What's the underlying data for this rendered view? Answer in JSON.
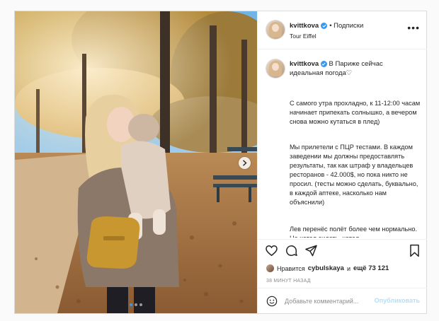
{
  "post": {
    "username": "kvittkova",
    "follow_label": "• Подписки",
    "location": "Tour Eiffel",
    "caption_first": "В Париже сейчас идеальная погода♡",
    "paragraphs": [
      "С самого утра прохладно, к 11-12:00 часам начинает припекать солнышко, а вечером снова можно кутаться в плед)",
      "Мы прилетели с ПЦР тестами. В каждом заведении мы должны предоставлять результаты, так как штраф у владельцев ресторанов - 42.000$, но пока никто не просил. (тесты можно сделать, буквально, в каждой аптеке, насколько нам объяснили)",
      "Лев перенёс полёт более чем нормально. Не хотел сидеть, хотел"
    ],
    "likes_prefix": "Нравится",
    "likes_user": "cybulskaya",
    "likes_mid": "и",
    "likes_count": "ещё 73 121",
    "time_ago": "38 МИНУТ НАЗАД",
    "comment_placeholder": "Добавьте комментарий...",
    "publish_label": "Опубликовать",
    "carousel": {
      "total": 3,
      "current": 1
    }
  },
  "icons": {
    "verified": "verified-badge-icon",
    "more": "more-options-icon",
    "like": "heart-icon",
    "comment": "comment-icon",
    "share": "share-icon",
    "save": "bookmark-icon",
    "emoji": "emoji-icon",
    "next": "chevron-right-icon"
  },
  "colors": {
    "accent": "#3897f0",
    "publish_disabled": "#b2dffc",
    "muted": "#8e8e8e"
  }
}
